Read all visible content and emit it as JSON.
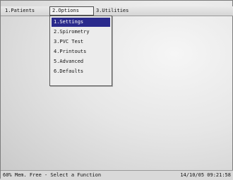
{
  "menubar": {
    "items": [
      {
        "label": "1.Patients"
      },
      {
        "label": "2.Options"
      },
      {
        "label": "3.Utilities"
      }
    ]
  },
  "dropdown": {
    "items": [
      {
        "label": "1.Settings"
      },
      {
        "label": "2.Spirometry"
      },
      {
        "label": "3.PVC Test"
      },
      {
        "label": "4.Printouts"
      },
      {
        "label": "5.Advanced"
      },
      {
        "label": "6.Defaults"
      }
    ],
    "selected_index": 0
  },
  "status": {
    "left": "60% Mem. Free - Select a Function",
    "right": "14/10/05 09:21:58"
  },
  "colors": {
    "selection": "#2a2a8c"
  }
}
